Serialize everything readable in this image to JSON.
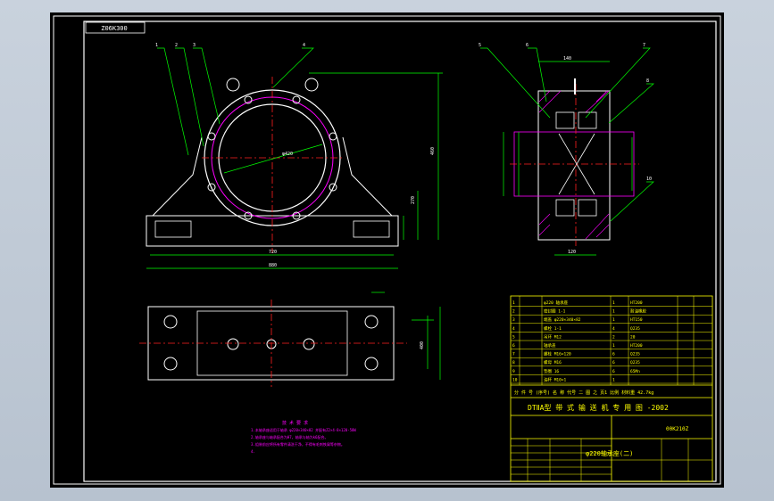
{
  "drawing": {
    "stamp": "Z06K300",
    "title_block": {
      "row_label": "分 件 号 (序号) 名 称 代号 二 图 之 页1 比例 材料重 42.7kg",
      "standard": "DTⅡA型 带 式 输 送 机 专 用 图 -2002",
      "code": "00K210Z",
      "part_name": "φ220轴承座(二)"
    },
    "notes_title": "技 术 要 求",
    "notes": [
      "1.本轴承座适用于轴承 φ220×340×82 并配有Z2×4-8×120-58W",
      "2.轴承座与轴承配合为H7，轴承与轴为k6配合。",
      "3.组装前应将所有零件清洗干净，不得有毛刺铁屑等杂物。",
      "4."
    ],
    "dims": {
      "d1": "φ420",
      "width": "720",
      "total": "880",
      "h1": "270",
      "h2": "460",
      "top": "140",
      "side": "120",
      "len": "400"
    },
    "bom_rows": [
      [
        "1",
        "",
        "φ220 轴承座",
        "1",
        "HT200",
        "",
        ""
      ],
      [
        "2",
        "",
        "密封圈 1-1",
        "1",
        "耐油橡胶",
        "",
        ""
      ],
      [
        "3",
        "",
        "端盖 φ220×340×82",
        "1",
        "HT150",
        "",
        ""
      ],
      [
        "4",
        "",
        "螺栓 1-1",
        "4",
        "Q235",
        "",
        ""
      ],
      [
        "5",
        "",
        "吊环 M12",
        "2",
        "20",
        "",
        ""
      ],
      [
        "6",
        "",
        "轴承盖",
        "1",
        "HT200",
        "",
        ""
      ],
      [
        "7",
        "",
        "螺栓 M16×120",
        "6",
        "Q235",
        "",
        ""
      ],
      [
        "8",
        "",
        "螺母 M16",
        "6",
        "Q235",
        "",
        ""
      ],
      [
        "9",
        "",
        "垫圈 16",
        "6",
        "65Mn",
        "",
        ""
      ],
      [
        "10",
        "",
        "油杯 M10×1",
        "1",
        "",
        "",
        ""
      ]
    ],
    "colors": {
      "outline": "#ffffff",
      "leader": "#00ff00",
      "center": "#ff2020",
      "hatch": "#ff00ff",
      "table": "#ffff00",
      "cyan": "#00ffff"
    }
  }
}
